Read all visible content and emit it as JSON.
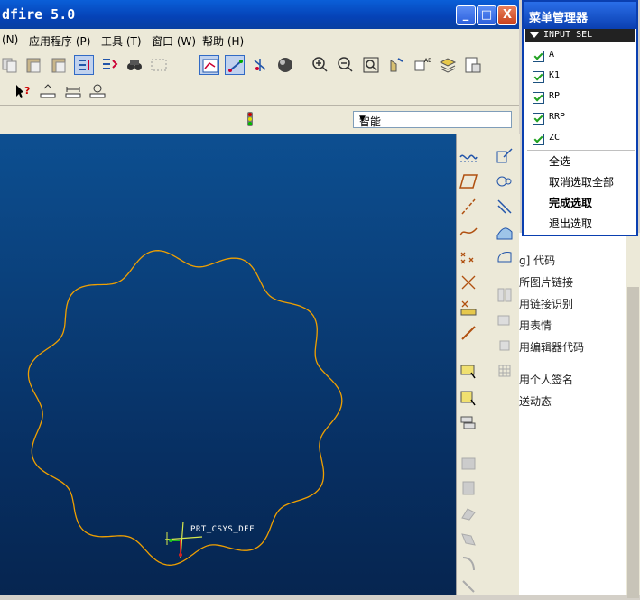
{
  "window": {
    "title": "dfire 5.0",
    "min_label": "_",
    "max_label": "□",
    "close_label": "X"
  },
  "menubar": {
    "items": [
      "(N)",
      "应用程序 (P)",
      "工具 (T)",
      "窗口 (W)",
      "帮助 (H)"
    ]
  },
  "filter": {
    "value": "智能"
  },
  "model": {
    "csys_label": "PRT_CSYS_DEF",
    "curve_color": "#f0a000"
  },
  "menu_manager": {
    "title": "菜单管理器",
    "section": "INPUT SEL",
    "items": [
      {
        "label": "A",
        "checked": true
      },
      {
        "label": "K1",
        "checked": true
      },
      {
        "label": "RP",
        "checked": true
      },
      {
        "label": "RRP",
        "checked": true
      },
      {
        "label": "ZC",
        "checked": true
      }
    ],
    "actions": {
      "select_all": "全选",
      "deselect_all": "取消选取全部",
      "done": "完成选取",
      "quit": "退出选取"
    }
  },
  "right_panel": {
    "links": [
      "g] 代码",
      "所图片链接",
      "用链接识别",
      "用表情",
      "用编辑器代码",
      "用个人签名",
      "送动态"
    ]
  }
}
